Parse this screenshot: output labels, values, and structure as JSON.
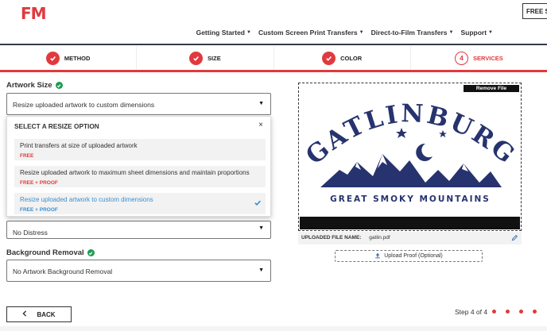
{
  "header": {
    "logo": "FM",
    "free_sample_label": "FREE SA",
    "nav": [
      "Getting Started",
      "Custom Screen Print Transfers",
      "Direct-to-Film Transfers",
      "Support"
    ]
  },
  "steps": [
    {
      "label": "METHOD",
      "state": "done"
    },
    {
      "label": "SIZE",
      "state": "done"
    },
    {
      "label": "COLOR",
      "state": "done"
    },
    {
      "label": "SERVICES",
      "state": "active",
      "number": "4"
    }
  ],
  "artwork_size": {
    "label": "Artwork Size",
    "selected": "Resize uploaded artwork to custom dimensions"
  },
  "resize_dropdown": {
    "header": "SELECT A RESIZE OPTION",
    "close": "×",
    "options": [
      {
        "title": "Print transfers at size of uploaded artwork",
        "price": "FREE",
        "selected": false
      },
      {
        "title": "Resize uploaded artwork to maximum sheet dimensions and maintain proportions",
        "price": "FREE + PROOF",
        "selected": false
      },
      {
        "title": "Resize uploaded artwork to custom dimensions",
        "price": "FREE + PROOF",
        "selected": true
      }
    ]
  },
  "distress": {
    "selected": "No Distress"
  },
  "background_removal": {
    "label": "Background Removal",
    "selected": "No Artwork Background Removal"
  },
  "preview": {
    "remove_file": "Remove File",
    "art_title": "GATLINBURG",
    "art_subtitle": "GREAT SMOKY MOUNTAINS",
    "file_name_label": "UPLOADED FILE NAME:",
    "file_name": "gatlin.pdf",
    "upload_proof": "Upload Proof (Optional)"
  },
  "footer": {
    "back": "BACK",
    "step_count": "Step 4 of 4"
  },
  "colors": {
    "accent": "#e03a3e",
    "success": "#1f9b53",
    "selected_blue": "#3a8fd1",
    "art_navy": "#27336e"
  }
}
